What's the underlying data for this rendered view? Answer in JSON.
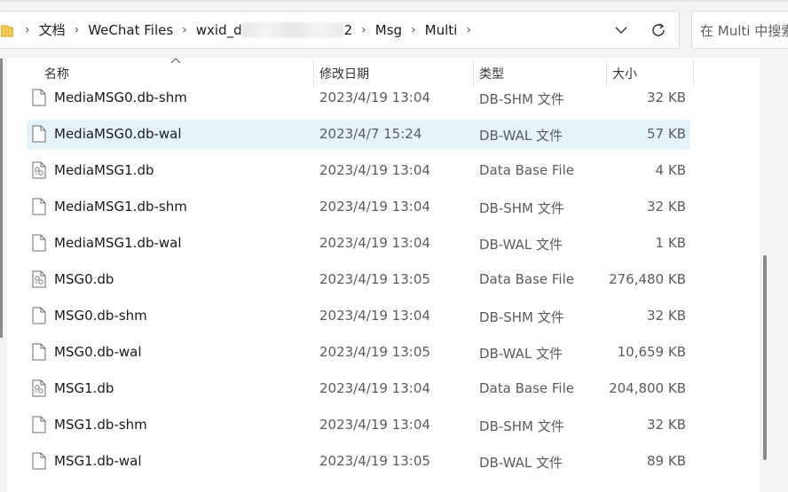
{
  "address": {
    "crumbs": [
      "文档",
      "WeChat Files",
      "wxid_d",
      "2",
      "Msg",
      "Multi"
    ]
  },
  "search": {
    "placeholder": "在 Multi 中搜索"
  },
  "columns": {
    "name": "名称",
    "date": "修改日期",
    "type": "类型",
    "size": "大小"
  },
  "files": [
    {
      "name": "MediaMSG0.db-shm",
      "date": "2023/4/19 13:04",
      "type": "DB-SHM 文件",
      "size": "32 KB",
      "icon": "generic-file-icon",
      "selected": false
    },
    {
      "name": "MediaMSG0.db-wal",
      "date": "2023/4/7 15:24",
      "type": "DB-WAL 文件",
      "size": "57 KB",
      "icon": "generic-file-icon",
      "selected": true
    },
    {
      "name": "MediaMSG1.db",
      "date": "2023/4/19 13:04",
      "type": "Data Base File",
      "size": "4 KB",
      "icon": "database-file-icon",
      "selected": false
    },
    {
      "name": "MediaMSG1.db-shm",
      "date": "2023/4/19 13:04",
      "type": "DB-SHM 文件",
      "size": "32 KB",
      "icon": "generic-file-icon",
      "selected": false
    },
    {
      "name": "MediaMSG1.db-wal",
      "date": "2023/4/19 13:04",
      "type": "DB-WAL 文件",
      "size": "1 KB",
      "icon": "generic-file-icon",
      "selected": false
    },
    {
      "name": "MSG0.db",
      "date": "2023/4/19 13:05",
      "type": "Data Base File",
      "size": "276,480 KB",
      "icon": "database-file-icon",
      "selected": false
    },
    {
      "name": "MSG0.db-shm",
      "date": "2023/4/19 13:04",
      "type": "DB-SHM 文件",
      "size": "32 KB",
      "icon": "generic-file-icon",
      "selected": false
    },
    {
      "name": "MSG0.db-wal",
      "date": "2023/4/19 13:05",
      "type": "DB-WAL 文件",
      "size": "10,659 KB",
      "icon": "generic-file-icon",
      "selected": false
    },
    {
      "name": "MSG1.db",
      "date": "2023/4/19 13:04",
      "type": "Data Base File",
      "size": "204,800 KB",
      "icon": "database-file-icon",
      "selected": false
    },
    {
      "name": "MSG1.db-shm",
      "date": "2023/4/19 13:04",
      "type": "DB-SHM 文件",
      "size": "32 KB",
      "icon": "generic-file-icon",
      "selected": false
    },
    {
      "name": "MSG1.db-wal",
      "date": "2023/4/19 13:05",
      "type": "DB-WAL 文件",
      "size": "89 KB",
      "icon": "generic-file-icon",
      "selected": false
    }
  ]
}
